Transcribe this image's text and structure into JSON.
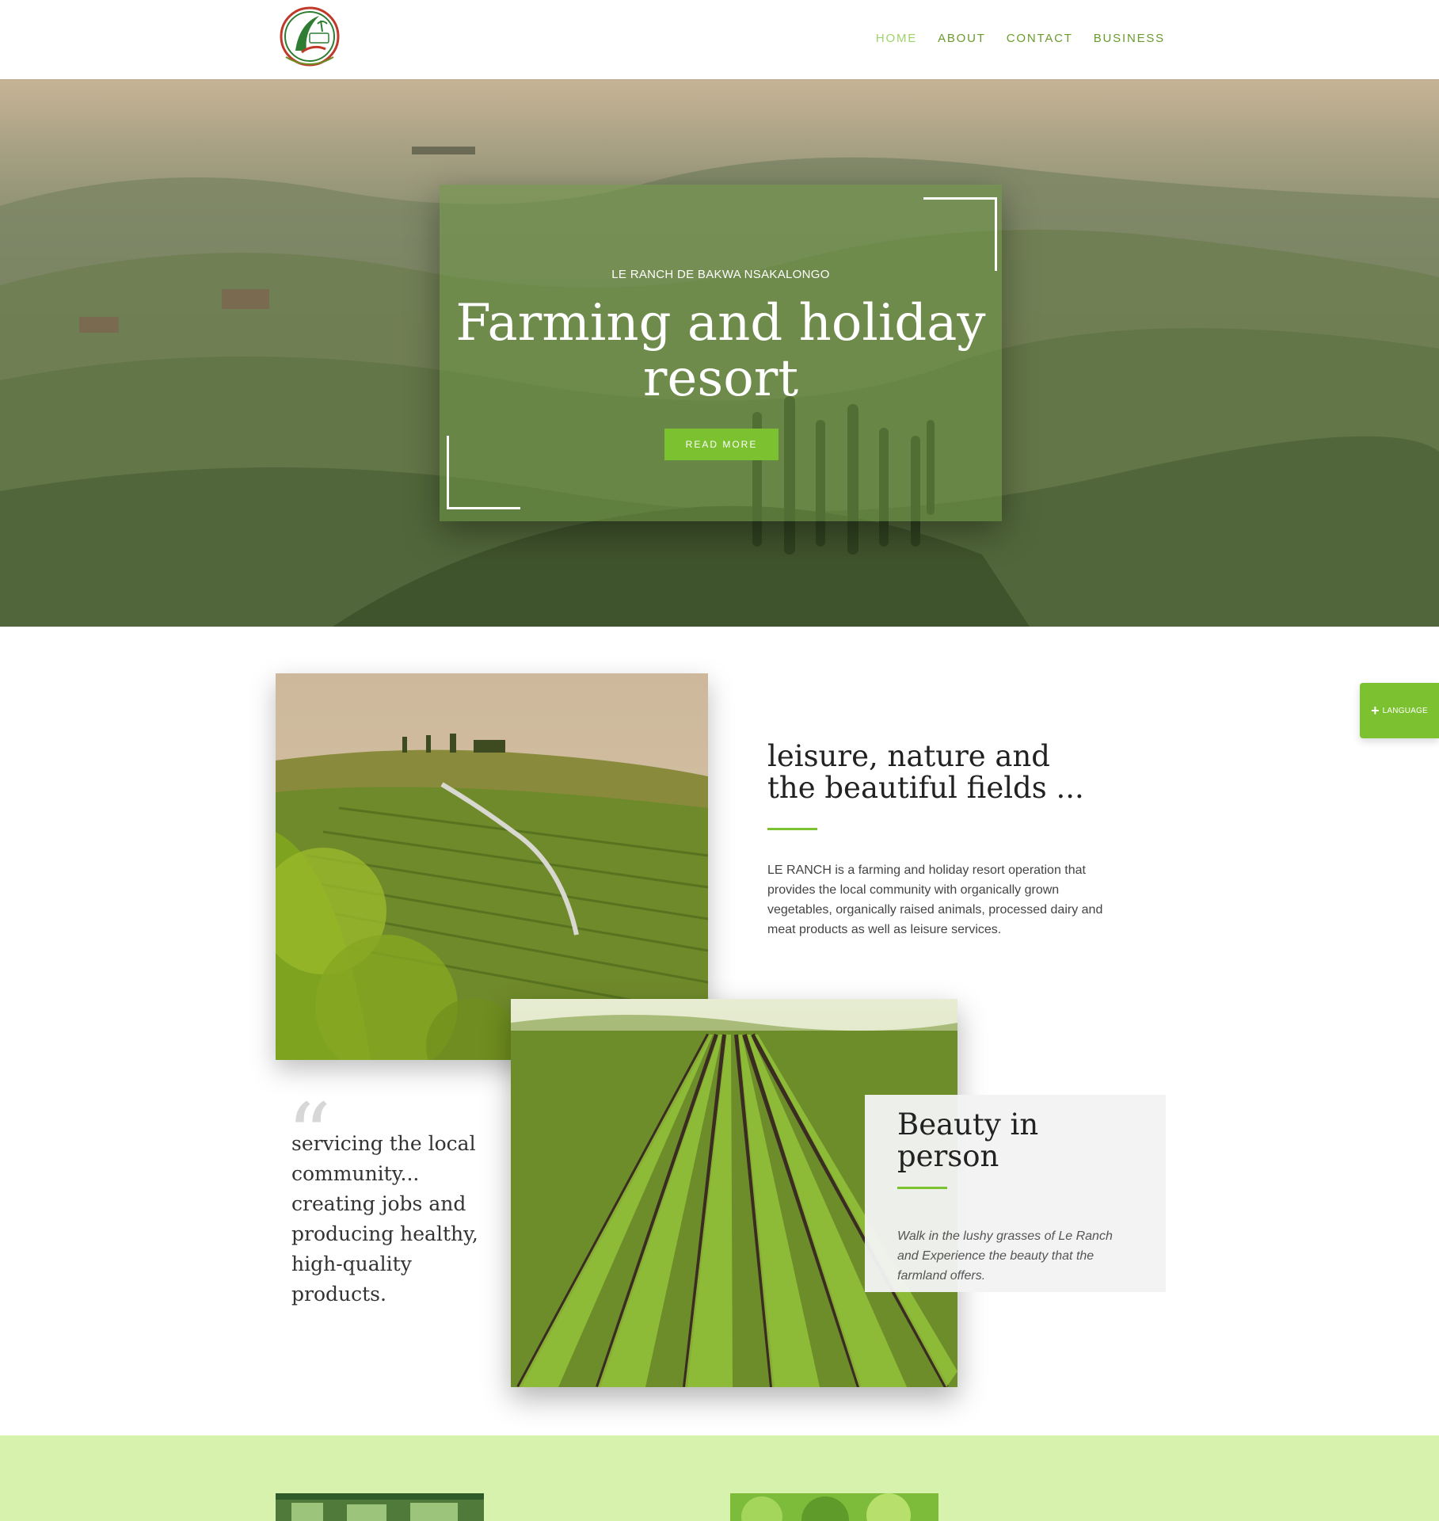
{
  "header": {
    "logo_icon": "le-ranch-logo",
    "nav": [
      {
        "label": "HOME",
        "active": true
      },
      {
        "label": "ABOUT",
        "active": false
      },
      {
        "label": "CONTACT",
        "active": false
      },
      {
        "label": "BUSINESS",
        "active": false
      }
    ]
  },
  "hero": {
    "kicker": "LE RANCH DE BAKWA NSAKALONGO",
    "title": "Farming and holiday resort",
    "button_label": "READ MORE"
  },
  "about": {
    "title": "leisure, nature and the beautiful fields ...",
    "text": "LE RANCH is a farming and holiday resort operation that provides the local community with organically grown vegetables, organically raised animals, processed dairy and meat products as well as leisure services."
  },
  "quote": {
    "mark": "“",
    "text": "servicing the local community... creating jobs and producing healthy, high-quality products."
  },
  "beauty": {
    "title": "Beauty in person",
    "text": "Walk in the lushy grasses of Le Ranch and Experience the beauty that the farmland offers."
  },
  "language_tab": {
    "plus": "+",
    "label": "LANGUAGE"
  },
  "colors": {
    "accent": "#7cc12f",
    "nav_text": "#6b9a2f",
    "nav_active": "#9ed36a",
    "band": "#d6f2ac"
  }
}
